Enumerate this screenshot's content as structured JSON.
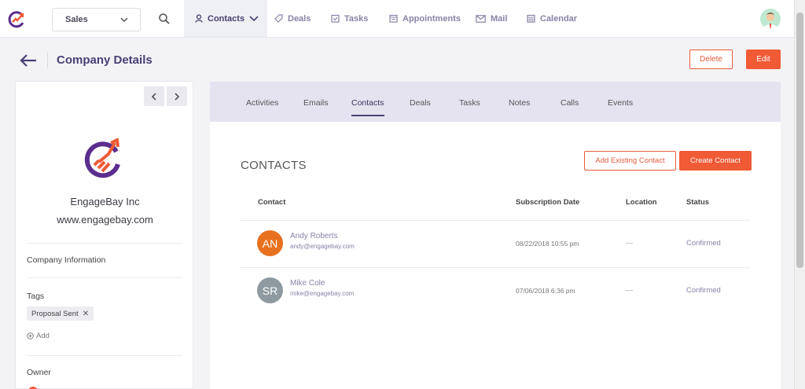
{
  "nav": {
    "selector_value": "Sales",
    "items": [
      {
        "label": "Contacts",
        "icon": "user-icon"
      },
      {
        "label": "Deals",
        "icon": "tag-icon"
      },
      {
        "label": "Tasks",
        "icon": "task-icon"
      },
      {
        "label": "Appointments",
        "icon": "appointments-icon"
      },
      {
        "label": "Mail",
        "icon": "mail-icon"
      },
      {
        "label": "Calendar",
        "icon": "calendar-icon"
      }
    ],
    "active": "Contacts"
  },
  "header": {
    "title": "Company Details",
    "delete_label": "Delete",
    "edit_label": "Edit"
  },
  "company": {
    "name": "EngageBay Inc",
    "website": "www.engagebay.com",
    "info_label": "Company Information",
    "tags_label": "Tags",
    "tags": [
      "Proposal Sent"
    ],
    "add_label": "Add",
    "owner_label": "Owner"
  },
  "tabs": {
    "items": [
      "Activities",
      "Emails",
      "Contacts",
      "Deals",
      "Tasks",
      "Notes",
      "Calls",
      "Events"
    ],
    "active": "Contacts"
  },
  "contacts": {
    "title": "CONTACTS",
    "add_existing_label": "Add Existing Contact",
    "create_label": "Create Contact",
    "columns": [
      "Contact",
      "Subscription Date",
      "Location",
      "Status"
    ],
    "rows": [
      {
        "initials": "AN",
        "name": "Andy Roberts",
        "email": "andy@engagebay.com",
        "date": "08/22/2018 10:55 pm",
        "location": "—",
        "status": "Confirmed"
      },
      {
        "initials": "SR",
        "name": "Mike Cole",
        "email": "mike@engagebay.com",
        "date": "07/06/2018 6:36 pm",
        "location": "—",
        "status": "Confirmed"
      }
    ]
  },
  "colors": {
    "accent": "#f05a35",
    "brand_purple": "#4a3f73",
    "avatar_an": "#e8711f",
    "avatar_sr": "#8e9aa0"
  }
}
